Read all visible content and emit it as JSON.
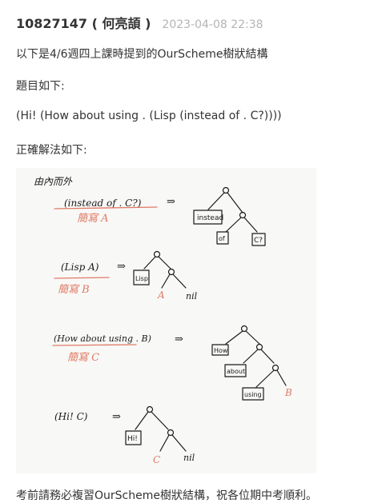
{
  "post": {
    "author": "10827147 ( 何亮頡 )",
    "date": "2023-04-08 22:38",
    "intro": "以下是4/6週四上課時提到的OurScheme樹狀結構",
    "question_label": "題目如下:",
    "expression": "(Hi! (How about using . (Lisp (instead of . C?))))",
    "solution_label": "正確解法如下:",
    "closing": "考前請務必複習OurScheme樹狀結構，祝各位期中考順利。"
  },
  "figure": {
    "heading": "由內而外",
    "steps": [
      {
        "expr": "(instead of . C?)",
        "abbr": "簡寫 A",
        "nodes": [
          "instead",
          "of",
          "C?"
        ]
      },
      {
        "expr": "(Lisp A)",
        "abbr": "簡寫 B",
        "nodes": [
          "Lisp",
          "A",
          "nil"
        ]
      },
      {
        "expr": "(How about using . B)",
        "abbr": "簡寫 C",
        "nodes": [
          "How",
          "about",
          "using",
          "B"
        ]
      },
      {
        "expr": "(Hi! C)",
        "nodes": [
          "Hi!",
          "C",
          "nil"
        ]
      }
    ],
    "colors": {
      "ink": "#1a1a1a",
      "annotation": "#e07a66",
      "paper": "#f8f8f6"
    }
  }
}
